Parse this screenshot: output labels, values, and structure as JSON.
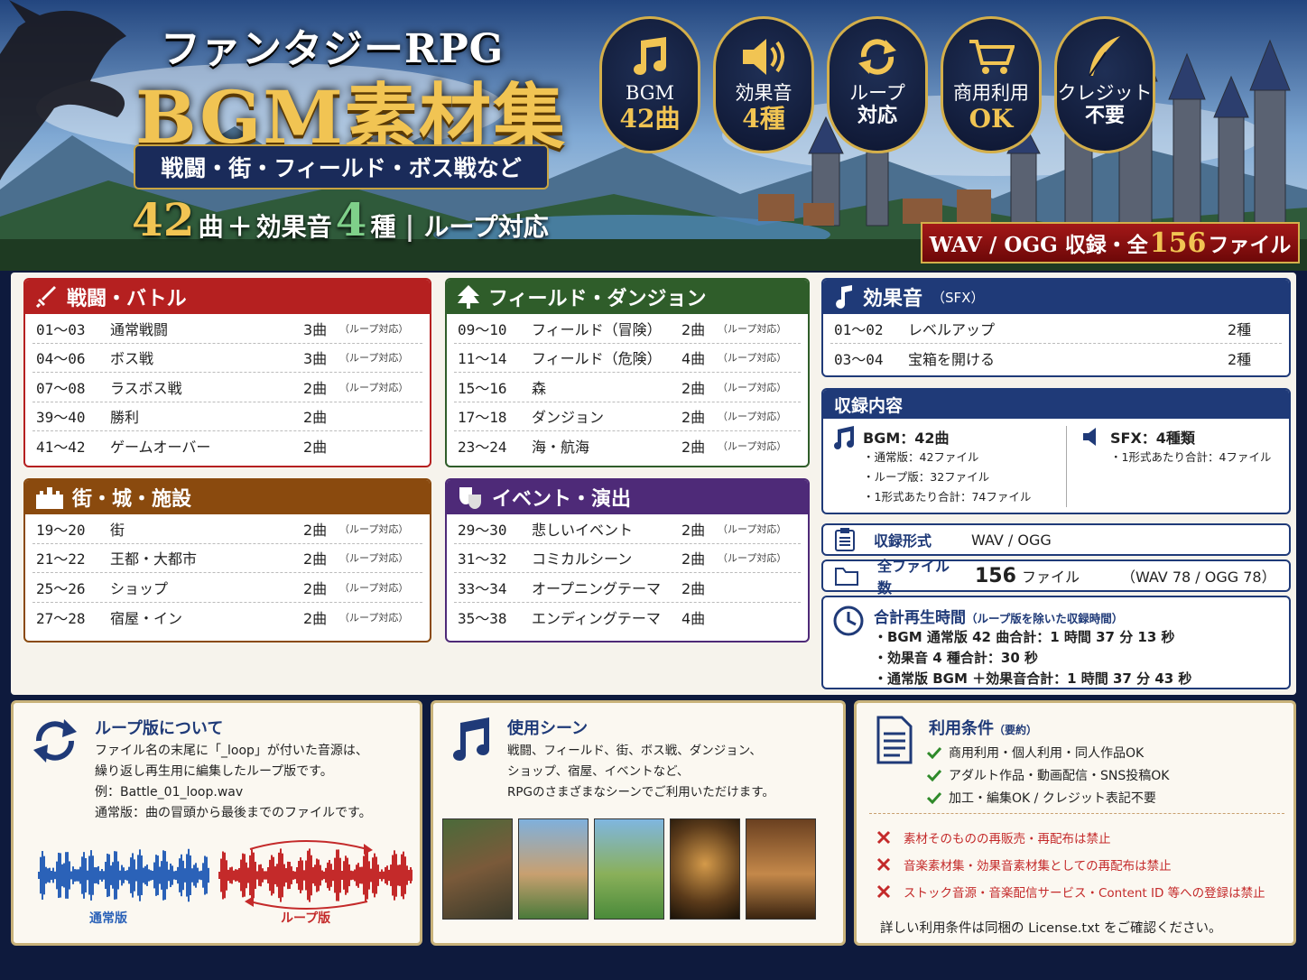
{
  "hero": {
    "title_small": "ファンタジーRPG",
    "title_big": "BGM素材集",
    "ribbon": "戦闘・街・フィールド・ボス戦など",
    "count_a": "42",
    "count_a_unit": "曲",
    "plus": "＋",
    "count_b_label": "効果音",
    "count_b": "4",
    "count_b_unit": "種",
    "sep": "|",
    "loop_text": "ループ対応",
    "badges": [
      {
        "icon": "music-note-icon",
        "l1": "BGM",
        "l2": "42曲"
      },
      {
        "icon": "speaker-icon",
        "l1": "効果音",
        "l2": "4種"
      },
      {
        "icon": "loop-icon",
        "l1": "ループ",
        "l2": "対応"
      },
      {
        "icon": "cart-icon",
        "l1": "商用利用",
        "l2": "OK"
      },
      {
        "icon": "feather-icon",
        "l1": "クレジット",
        "l2": "不要"
      }
    ],
    "wav_pre": "WAV / OGG 収録・全",
    "wav_num": "156",
    "wav_post": "ファイル"
  },
  "battle": {
    "title": "戦闘・バトル",
    "rows": [
      {
        "range": "01～03",
        "name": "通常戦闘",
        "count": "3曲",
        "loop": "（ループ対応）"
      },
      {
        "range": "04～06",
        "name": "ボス戦",
        "count": "3曲",
        "loop": "（ループ対応）"
      },
      {
        "range": "07～08",
        "name": "ラスボス戦",
        "count": "2曲",
        "loop": "（ループ対応）"
      },
      {
        "range": "39～40",
        "name": "勝利",
        "count": "2曲",
        "loop": ""
      },
      {
        "range": "41～42",
        "name": "ゲームオーバー",
        "count": "2曲",
        "loop": ""
      }
    ]
  },
  "field": {
    "title": "フィールド・ダンジョン",
    "rows": [
      {
        "range": "09～10",
        "name": "フィールド（冒険）",
        "count": "2曲",
        "loop": "（ループ対応）"
      },
      {
        "range": "11～14",
        "name": "フィールド（危険）",
        "count": "4曲",
        "loop": "（ループ対応）"
      },
      {
        "range": "15～16",
        "name": "森",
        "count": "2曲",
        "loop": "（ループ対応）"
      },
      {
        "range": "17～18",
        "name": "ダンジョン",
        "count": "2曲",
        "loop": "（ループ対応）"
      },
      {
        "range": "23～24",
        "name": "海・航海",
        "count": "2曲",
        "loop": "（ループ対応）"
      }
    ]
  },
  "town": {
    "title": "街・城・施設",
    "rows": [
      {
        "range": "19～20",
        "name": "街",
        "count": "2曲",
        "loop": "（ループ対応）"
      },
      {
        "range": "21～22",
        "name": "王都・大都市",
        "count": "2曲",
        "loop": "（ループ対応）"
      },
      {
        "range": "25～26",
        "name": "ショップ",
        "count": "2曲",
        "loop": "（ループ対応）"
      },
      {
        "range": "27～28",
        "name": "宿屋・イン",
        "count": "2曲",
        "loop": "（ループ対応）"
      }
    ]
  },
  "event": {
    "title": "イベント・演出",
    "rows": [
      {
        "range": "29～30",
        "name": "悲しいイベント",
        "count": "2曲",
        "loop": "（ループ対応）"
      },
      {
        "range": "31～32",
        "name": "コミカルシーン",
        "count": "2曲",
        "loop": "（ループ対応）"
      },
      {
        "range": "33～34",
        "name": "オープニングテーマ",
        "count": "2曲",
        "loop": ""
      },
      {
        "range": "35～38",
        "name": "エンディングテーマ",
        "count": "4曲",
        "loop": ""
      }
    ]
  },
  "sfx": {
    "title": "効果音",
    "title_sub": "（SFX）",
    "rows": [
      {
        "range": "01～02",
        "name": "レベルアップ",
        "count": "2種"
      },
      {
        "range": "03～04",
        "name": "宝箱を開ける",
        "count": "2種"
      }
    ]
  },
  "contents": {
    "title": "収録内容",
    "bgm_head": "BGM：42曲",
    "bgm_items": [
      "・通常版：42ファイル",
      "・ループ版：32ファイル",
      "・1形式あたり合計：74ファイル"
    ],
    "sfx_head": "SFX：4種類",
    "sfx_items": [
      "・1形式あたり合計：4ファイル"
    ]
  },
  "format": {
    "label": "収録形式",
    "value": "WAV / OGG"
  },
  "files": {
    "label": "全ファイル数",
    "num": "156",
    "unit": "ファイル",
    "detail": "（WAV 78 / OGG 78）"
  },
  "duration": {
    "title": "合計再生時間",
    "title_sub": "（ループ版を除いた収録時間）",
    "items": [
      "・BGM 通常版 42 曲合計：1 時間 37 分 13 秒",
      "・効果音 4 種合計：30 秒",
      "・通常版 BGM ＋効果音合計：1 時間 37 分 43 秒"
    ]
  },
  "loop_info": {
    "title": "ループ版について",
    "lines": [
      "ファイル名の末尾に「_loop」が付いた音源は、",
      "繰り返し再生用に編集したループ版です。",
      "例：Battle_01_loop.wav",
      "通常版：曲の冒頭から最後までのファイルです。"
    ],
    "normal_label": "通常版",
    "loop_label": "ループ版"
  },
  "scenes": {
    "title": "使用シーン",
    "lines": [
      "戦闘、フィールド、街、ボス戦、ダンジョン、",
      "ショップ、宿屋、イベントなど、",
      "RPGのさまざまなシーンでご利用いただけます。"
    ]
  },
  "terms": {
    "title": "利用条件",
    "title_sub": "（要約）",
    "ok": [
      "商用利用・個人利用・同人作品OK",
      "アダルト作品・動画配信・SNS投稿OK",
      "加工・編集OK / クレジット表記不要"
    ],
    "ng": [
      "素材そのものの再販売・再配布は禁止",
      "音楽素材集・効果音素材集としての再配布は禁止",
      "ストック音源・音楽配信サービス・Content ID 等への登録は禁止"
    ],
    "footer": "詳しい利用条件は同梱の License.txt をご確認ください。"
  },
  "colors": {
    "red": "#b52020",
    "green": "#2f5d2a",
    "brown": "#8a4a0e",
    "purple": "#4e2a78",
    "navy": "#1f3a78",
    "gold": "#f1c453"
  }
}
